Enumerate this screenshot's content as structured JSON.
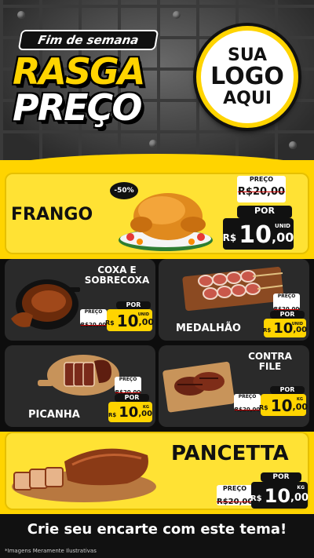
{
  "header": {
    "tagline": "Fim de semana",
    "title_line1": "RASGA",
    "title_line2": "PREÇO",
    "logo_lines": [
      "SUA",
      "LOGO",
      "AQUI"
    ]
  },
  "products": {
    "frango": {
      "name": "FRANGO",
      "discount_badge": "-50%",
      "price_label": "PREÇO",
      "old_price": "R$20,00",
      "por_label": "POR",
      "currency": "R$",
      "price_int": "10",
      "price_dec": ",00",
      "unit": "UNID"
    },
    "coxa": {
      "name_line1": "COXA E",
      "name_line2": "SOBRECOXA",
      "price_label": "PREÇO",
      "old_price": "R$20,00",
      "por_label": "POR",
      "currency": "R$",
      "price_int": "10",
      "price_dec": ",00",
      "unit": "UNID"
    },
    "medalhao": {
      "name": "MEDALHÃO",
      "price_label": "PREÇO",
      "old_price": "R$20,00",
      "por_label": "POR",
      "currency": "R$",
      "price_int": "10",
      "price_dec": ",00",
      "unit": "UNID"
    },
    "picanha": {
      "name": "PICANHA",
      "price_label": "PREÇO",
      "old_price": "R$20,00",
      "por_label": "POR",
      "currency": "R$",
      "price_int": "10",
      "price_dec": ",00",
      "unit": "KG"
    },
    "contra_file": {
      "name_line1": "CONTRA",
      "name_line2": "FILE",
      "price_label": "PREÇO",
      "old_price": "R$20,00",
      "por_label": "POR",
      "currency": "R$",
      "price_int": "10",
      "price_dec": ",00",
      "unit": "KG"
    },
    "pancetta": {
      "name": "PANCETTA",
      "price_label": "PREÇO",
      "old_price": "R$20,00",
      "por_label": "POR",
      "currency": "R$",
      "price_int": "10",
      "price_dec": ",00",
      "unit": "KG"
    }
  },
  "footer": {
    "cta": "Crie seu encarte com este tema!",
    "disclaimer": "*Imagens Meramente Ilustrativas"
  },
  "colors": {
    "accent_yellow": "#ffd400",
    "card_dark": "#2a2a2a",
    "black": "#111111"
  }
}
